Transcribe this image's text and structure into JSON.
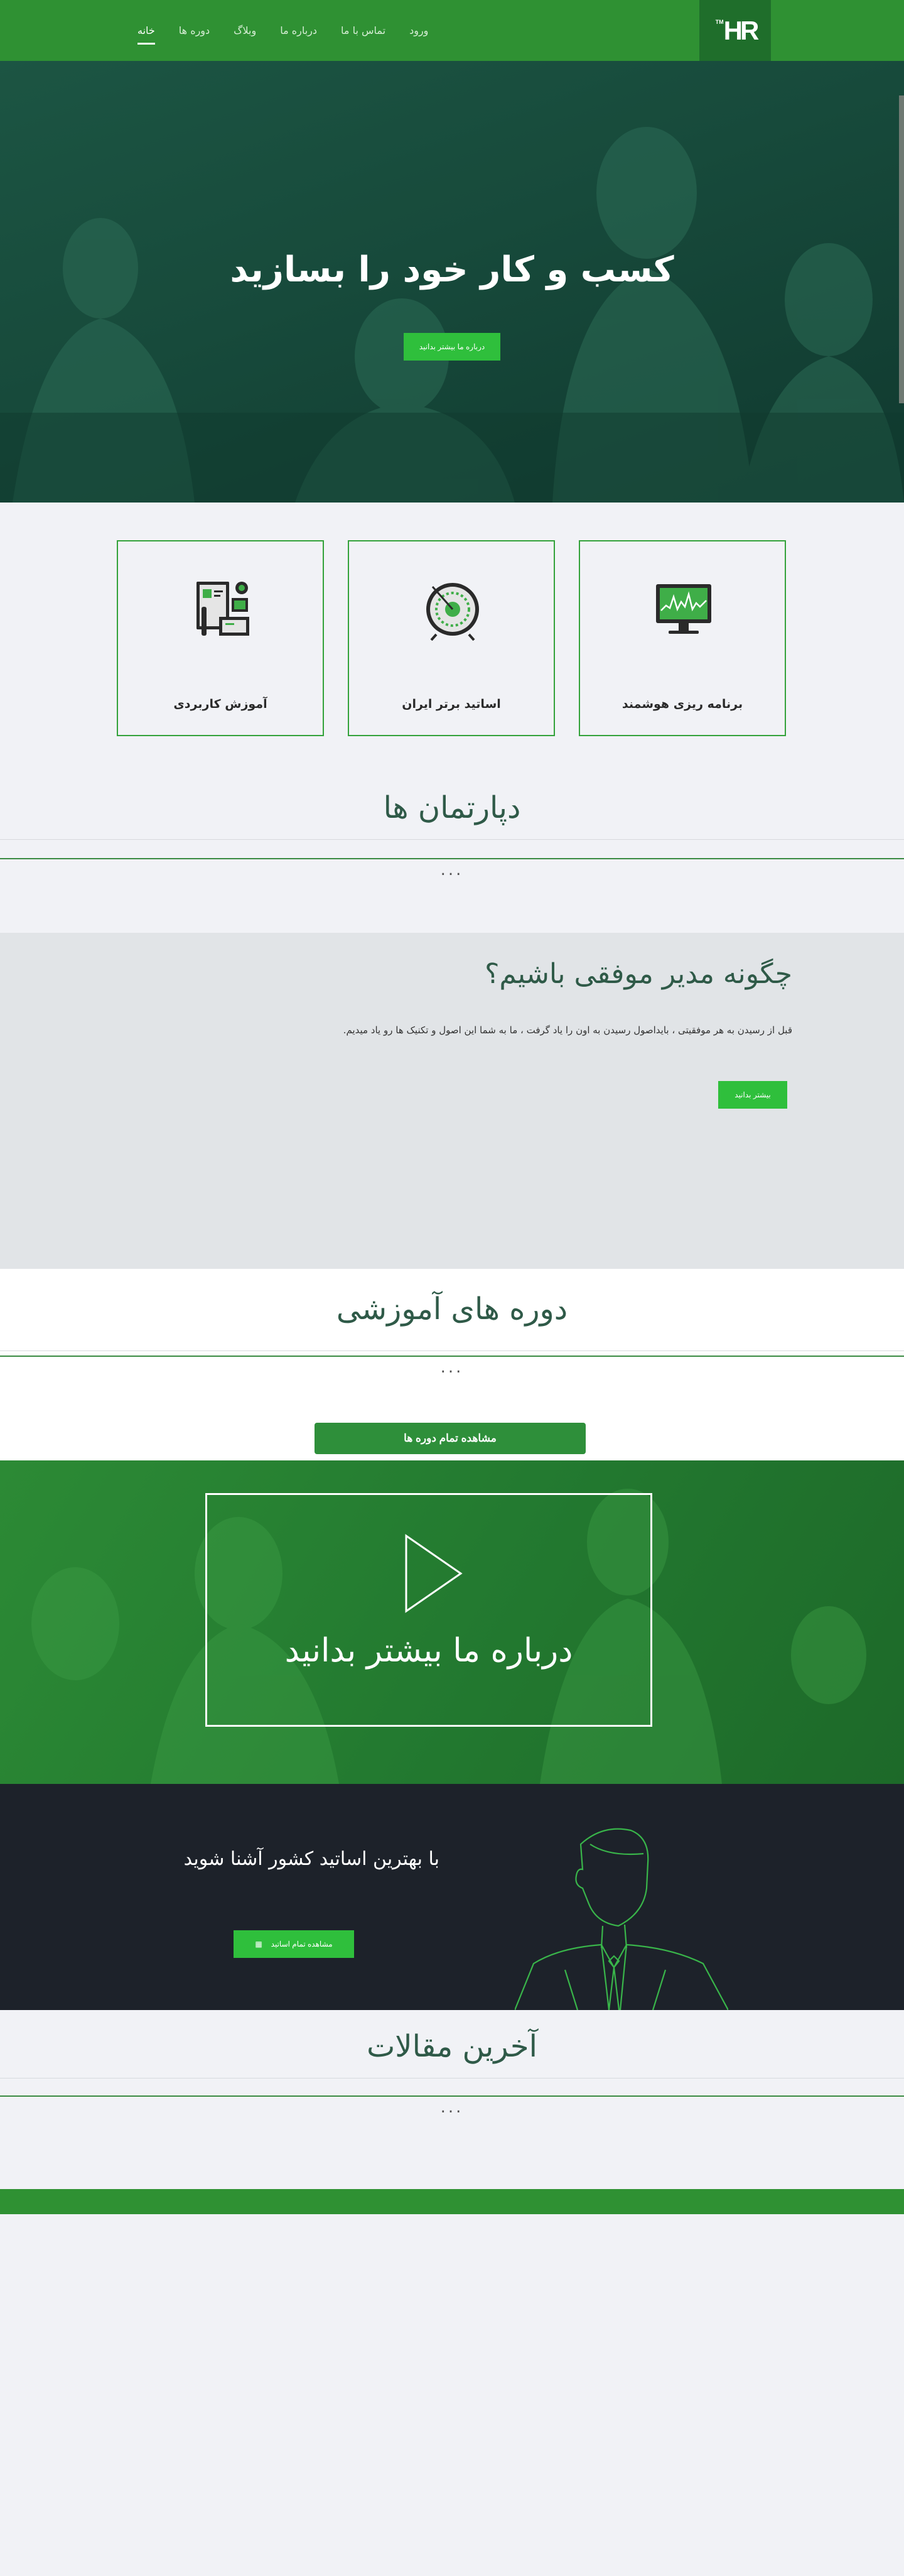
{
  "nav": {
    "logo": "HR",
    "logo_tm": "TM",
    "items": [
      {
        "label": "خانه",
        "active": true
      },
      {
        "label": "دوره ها",
        "active": false
      },
      {
        "label": "وبلاگ",
        "active": false
      },
      {
        "label": "درباره ما",
        "active": false
      },
      {
        "label": "تماس با ما",
        "active": false
      },
      {
        "label": "ورود",
        "active": false
      }
    ]
  },
  "hero": {
    "title": "کسب و کار خود را بسازید",
    "button": "درباره ما بیشتر بدانید"
  },
  "features": [
    {
      "label": "برنامه ریزی هوشمند",
      "icon": "monitor-chart-icon"
    },
    {
      "label": "اساتید برتر ایران",
      "icon": "target-icon"
    },
    {
      "label": "آموزش کاربردی",
      "icon": "documents-icon"
    }
  ],
  "departments": {
    "title": "دپارتمان ها",
    "dots": "..."
  },
  "success": {
    "title": "چگونه مدیر موفقی باشیم؟",
    "text": "قبل از رسیدن به هر موفقیتی ، بایداصول رسیدن به اون را یاد گرفت ، ما به شما این اصول و تکنیک ها رو یاد میدیم.",
    "button": "بیشتر بدانید"
  },
  "courses": {
    "title": "دوره های آموزشی",
    "dots": "...",
    "button": "مشاهده تمام دوره ها"
  },
  "video": {
    "caption": "درباره ما بیشتر بدانید"
  },
  "teachers": {
    "text": "با بهترین اساتید کشور آشنا شوید",
    "button": "مشاهده تمام اساتید"
  },
  "articles": {
    "title": "آخرین مقالات",
    "dots": "..."
  },
  "colors": {
    "primary": "#2f9133",
    "accent": "#2fbf3c",
    "dark": "#1d222a",
    "heading": "#2f5a48"
  }
}
